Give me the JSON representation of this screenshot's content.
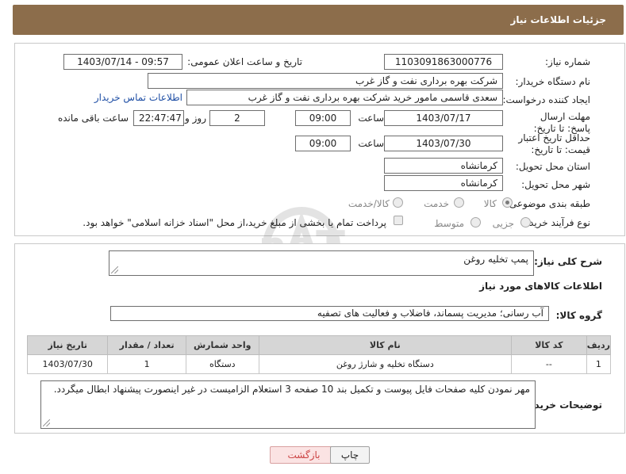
{
  "header": {
    "title": "جزئیات اطلاعات نیاز"
  },
  "form": {
    "need_number_label": "شماره نیاز:",
    "need_number": "1103091863000776",
    "announce_label": "تاریخ و ساعت اعلان عمومی:",
    "announce_value": "1403/07/14 - 09:57",
    "buyer_org_label": "نام دستگاه خریدار:",
    "buyer_org": "شرکت بهره برداری نفت و گاز غرب",
    "creator_label": "ایجاد کننده درخواست:",
    "creator": "سعدی قاسمی مامور خرید شرکت بهره برداری نفت و گاز غرب",
    "contact_link": "اطلاعات تماس خریدار",
    "reply_deadline_label": "مهلت ارسال پاسخ: تا تاریخ:",
    "reply_date": "1403/07/17",
    "time_label": "ساعت",
    "reply_time": "09:00",
    "days_value": "2",
    "days_label": "روز و",
    "remaining_time": "22:47:47",
    "remaining_label": "ساعت باقی مانده",
    "price_deadline_label": "حداقل تاریخ اعتبار قیمت: تا تاریخ:",
    "price_date": "1403/07/30",
    "price_time": "09:00",
    "province_label": "استان محل تحویل:",
    "province": "کرمانشاه",
    "city_label": "شهر محل تحویل:",
    "city": "کرمانشاه",
    "category_label": "طبقه بندی موضوعی:",
    "category_options": [
      "کالا",
      "خدمت",
      "کالا/خدمت"
    ],
    "process_label": "نوع فرآیند خرید :",
    "process_options": [
      "جزیی",
      "متوسط"
    ],
    "payment_note": "پرداخت تمام یا بخشی از مبلغ خرید،از محل \"اسناد خزانه اسلامی\" خواهد بود."
  },
  "details": {
    "summary_label": "شرح کلی نیاز:",
    "summary": "پمپ تخلیه روغن",
    "goods_info_title": "اطلاعات کالاهای مورد نیاز",
    "group_label": "گروه کالا:",
    "group": "آب رسانی؛ مدیریت پسماند، فاضلاب و فعالیت های تصفیه",
    "table": {
      "headers": [
        "ردیف",
        "کد کالا",
        "نام کالا",
        "واحد شمارش",
        "تعداد / مقدار",
        "تاریخ نیاز"
      ],
      "rows": [
        [
          "1",
          "--",
          "دستگاه تخلیه و شارژ روغن",
          "دستگاه",
          "1",
          "1403/07/30"
        ]
      ]
    },
    "buyer_notes_label": "توضیحات خریدار:",
    "buyer_notes": "مهر نمودن کلیه صفحات فایل پیوست و تکمیل بند 10 صفحه 3 استعلام الزامیست در غیر اینصورت پیشنهاد ابطال میگردد."
  },
  "buttons": {
    "print": "چاپ",
    "back": "بازگشت"
  },
  "watermark": "AriaTender.neT"
}
